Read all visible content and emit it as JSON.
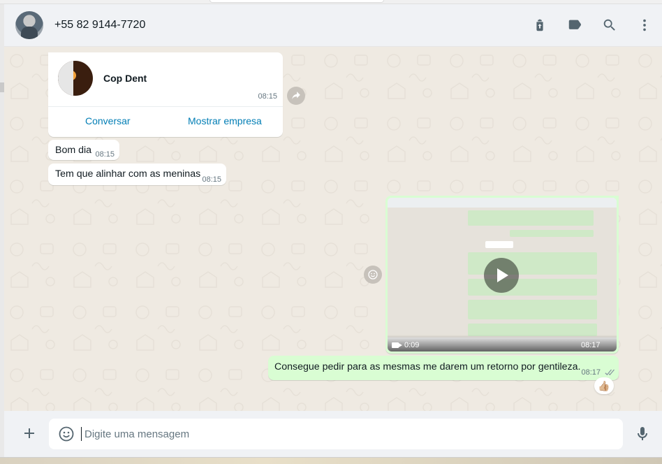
{
  "header": {
    "contact_name": "+55 82 9144-7720",
    "icons": [
      "archive-icon",
      "label-icon",
      "search-icon",
      "menu-icon"
    ]
  },
  "messages": {
    "business_card": {
      "name": "Cop Dent",
      "time": "08:15",
      "chat_action": "Conversar",
      "profile_action": "Mostrar empresa"
    },
    "greeting": {
      "text": "Bom dia",
      "time": "08:15"
    },
    "align": {
      "text": "Tem que alinhar com as meninas",
      "time": "08:15"
    },
    "video": {
      "duration": "0:09",
      "time": "08:17"
    },
    "request": {
      "text": "Consegue pedir para as mesmas me darem um retorno por gentileza.",
      "time": "08:17",
      "reaction": "👍🏼"
    }
  },
  "composer": {
    "placeholder": "Digite uma mensagem"
  },
  "colors": {
    "outgoing_bubble": "#d9fdd3",
    "chat_background": "#efeae2",
    "link_blue": "#027eb5"
  }
}
